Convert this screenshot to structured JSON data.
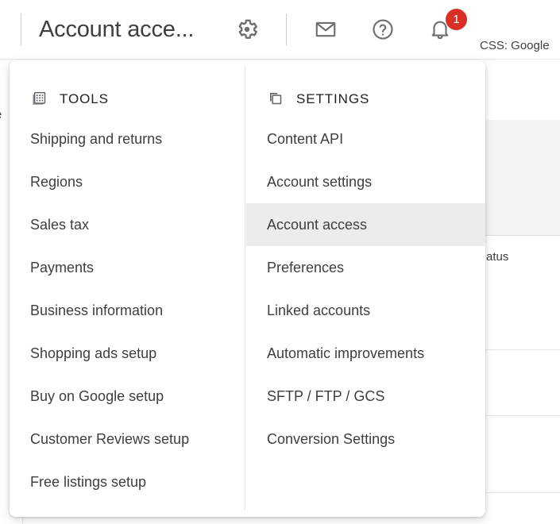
{
  "header": {
    "title": "Account acce...",
    "gear_icon": "gear-icon",
    "mail_icon": "mail-icon",
    "help_icon": "help-circle-icon",
    "bell_icon": "bell-icon",
    "notification_count": "1",
    "notification_badge_color": "#d93025",
    "css_label": "CSS: Google"
  },
  "menu": {
    "tools": {
      "icon": "grid-calculator-icon",
      "heading": "TOOLS",
      "items": [
        {
          "label": "Shipping and returns"
        },
        {
          "label": "Regions"
        },
        {
          "label": "Sales tax"
        },
        {
          "label": "Payments"
        },
        {
          "label": "Business information"
        },
        {
          "label": "Shopping ads setup"
        },
        {
          "label": "Buy on Google setup"
        },
        {
          "label": "Customer Reviews setup"
        },
        {
          "label": "Free listings setup"
        }
      ]
    },
    "settings": {
      "icon": "layers-copy-icon",
      "heading": "SETTINGS",
      "selected": "Account access",
      "selected_bg": "#ececec",
      "items": [
        {
          "label": "Content API"
        },
        {
          "label": "Account settings"
        },
        {
          "label": "Account access"
        },
        {
          "label": "Preferences"
        },
        {
          "label": "Linked accounts"
        },
        {
          "label": "Automatic improvements"
        },
        {
          "label": "SFTP / FTP / GCS"
        },
        {
          "label": "Conversion Settings"
        }
      ]
    }
  },
  "background": {
    "left_text_fragment": "e",
    "right_text_fragment": "atus"
  }
}
